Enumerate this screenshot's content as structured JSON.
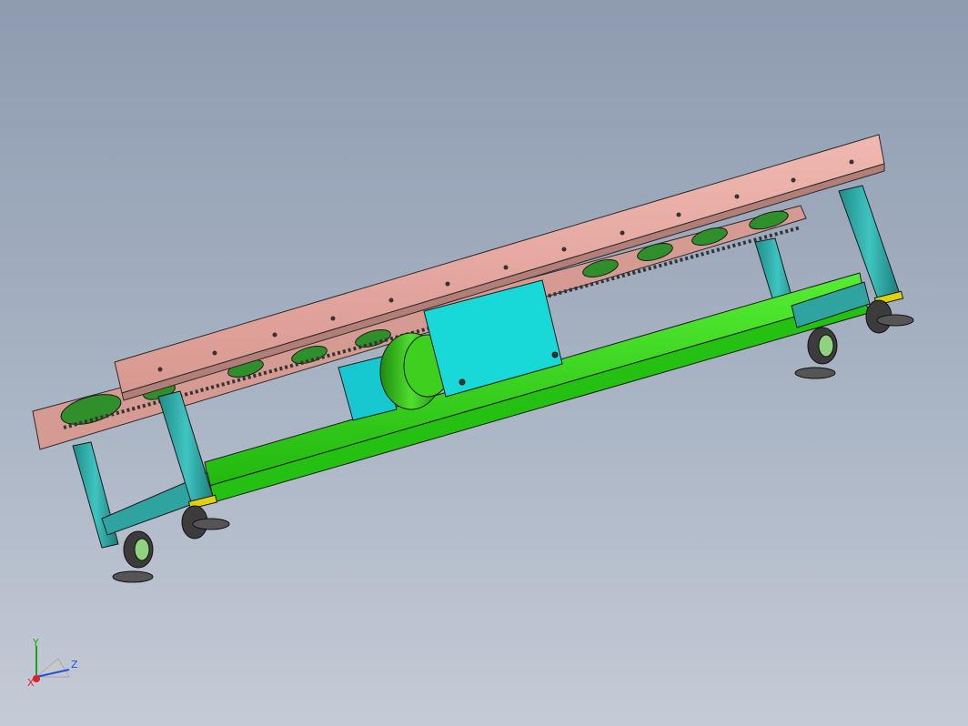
{
  "viewport": {
    "background_top": "#8e9bb0",
    "background_bottom": "#c5cbd6"
  },
  "model": {
    "frame_color": "#e8aaa2",
    "conveyor_rail_color": "#d89c94",
    "roller_color": "#2f8f2a",
    "leg_color": "#2fa3a0",
    "base_beam_color": "#33dd1a",
    "motor_color": "#33c21a",
    "motor_cover_color": "#18d8d8",
    "caster_color": "#3c3c3c",
    "caster_wheel_hub_color": "#8fd37f"
  },
  "triad": {
    "x_label": "X",
    "y_label": "Y",
    "z_label": "Z",
    "x_color": "#e0202c",
    "y_color": "#20a020",
    "z_color": "#2050e0"
  }
}
